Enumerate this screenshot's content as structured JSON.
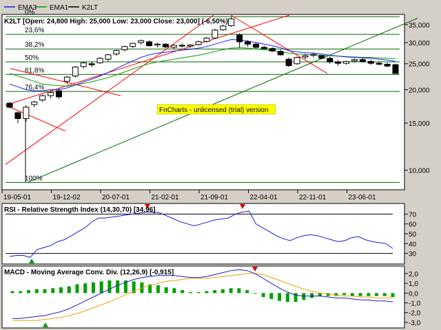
{
  "legend": [
    {
      "name": "EMA3",
      "color": "#1a1aff"
    },
    {
      "name": "EMA1",
      "color": "#00a000"
    },
    {
      "name": "K2LT",
      "color": "#000000"
    }
  ],
  "price_panel": {
    "header": "K2LT [Open: 24,800  High: 25,000  Low: 23,000  Close: 23,000] (-6,50%)",
    "y_ticks": [
      "35,000",
      "30,000",
      "25,000",
      "20,000",
      "15,000",
      "10,000"
    ],
    "x_ticks": [
      "19-05-01",
      "19-12-02",
      "20-07-01",
      "21-02-01",
      "21-09-01",
      "22-04-01",
      "22-11-01",
      "23-06-01"
    ],
    "fib_levels": [
      {
        "label": "0%",
        "value": 37500
      },
      {
        "label": "23,6%",
        "value": 32200
      },
      {
        "label": "38,2%",
        "value": 28400
      },
      {
        "label": "50%",
        "value": 25400
      },
      {
        "label": "61,8%",
        "value": 22800
      },
      {
        "label": "76,4%",
        "value": 19700
      },
      {
        "label": "100%",
        "value": 9000
      }
    ],
    "watermark": "FnCharts - unlicensed (trial) version"
  },
  "rsi_panel": {
    "title": "RSI - Relative Strength Index (14,30,70) [34,96]",
    "y_ticks": [
      "70",
      "60",
      "50",
      "40",
      "30"
    ],
    "overbought": 70,
    "oversold": 30
  },
  "macd_panel": {
    "title": "MACD - Moving Average Conv. Div. (12,26,9) [-0,915]",
    "y_ticks": [
      "2,0",
      "1,0",
      "0,0",
      "-1,0",
      "-2,0",
      "-3,0"
    ]
  },
  "colors": {
    "price_line": "#000000",
    "ema_blue": "#1a1aff",
    "ema_green": "#00a000",
    "trend_red": "#ff0000",
    "fib_green": "#006400",
    "rsi_line": "#1a1acc",
    "macd_line": "#1a1acc",
    "signal_line": "#f0a000",
    "hist_bar": "#00a000",
    "watermark_bg": "#ffff00"
  },
  "chart_data": {
    "type": "candlestick",
    "x_range_labels": [
      "19-05-01",
      "23-06-01"
    ],
    "y_scale": "log",
    "ylim": [
      8500,
      38000
    ],
    "candles": [
      {
        "open": 17800,
        "high": 18000,
        "low": 17000,
        "close": 17200
      },
      {
        "open": 16400,
        "high": 16600,
        "low": 15000,
        "close": 15600
      },
      {
        "open": 15600,
        "high": 17500,
        "low": 15200,
        "close": 17200
      },
      {
        "open": 17600,
        "high": 18200,
        "low": 17200,
        "close": 18000
      },
      {
        "open": 18300,
        "high": 19200,
        "low": 18000,
        "close": 19000
      },
      {
        "open": 19000,
        "high": 19800,
        "low": 18600,
        "close": 19500
      },
      {
        "open": 19800,
        "high": 20200,
        "low": 18500,
        "close": 18800
      },
      {
        "open": 21500,
        "high": 22500,
        "low": 21000,
        "close": 22300
      },
      {
        "open": 22500,
        "high": 24500,
        "low": 22200,
        "close": 24300
      },
      {
        "open": 24400,
        "high": 25500,
        "low": 24000,
        "close": 25200
      },
      {
        "open": 25000,
        "high": 25500,
        "low": 24300,
        "close": 24800
      },
      {
        "open": 25200,
        "high": 26500,
        "low": 25000,
        "close": 26200
      },
      {
        "open": 26000,
        "high": 27200,
        "low": 25500,
        "close": 27000
      },
      {
        "open": 27200,
        "high": 28200,
        "low": 26800,
        "close": 28000
      },
      {
        "open": 28200,
        "high": 29200,
        "low": 27800,
        "close": 29000
      },
      {
        "open": 29000,
        "high": 30000,
        "low": 28600,
        "close": 29800
      },
      {
        "open": 30000,
        "high": 30800,
        "low": 29500,
        "close": 30500
      },
      {
        "open": 30200,
        "high": 30600,
        "low": 29000,
        "close": 29200
      },
      {
        "open": 29400,
        "high": 30000,
        "low": 28800,
        "close": 29600
      },
      {
        "open": 29600,
        "high": 29800,
        "low": 28600,
        "close": 28900
      },
      {
        "open": 28800,
        "high": 29500,
        "low": 28400,
        "close": 29300
      },
      {
        "open": 29300,
        "high": 29800,
        "low": 28800,
        "close": 29100
      },
      {
        "open": 29100,
        "high": 29600,
        "low": 28700,
        "close": 29400
      },
      {
        "open": 29500,
        "high": 30500,
        "low": 29200,
        "close": 30200
      },
      {
        "open": 30300,
        "high": 31500,
        "low": 30000,
        "close": 31200
      },
      {
        "open": 31200,
        "high": 33800,
        "low": 31000,
        "close": 33400
      },
      {
        "open": 33500,
        "high": 35000,
        "low": 33200,
        "close": 34600
      },
      {
        "open": 34700,
        "high": 37500,
        "low": 34300,
        "close": 36800
      },
      {
        "open": 32000,
        "high": 32500,
        "low": 28800,
        "close": 30200
      },
      {
        "open": 30200,
        "high": 30600,
        "low": 29000,
        "close": 29600
      },
      {
        "open": 29600,
        "high": 30000,
        "low": 28400,
        "close": 28800
      },
      {
        "open": 28800,
        "high": 29200,
        "low": 28300,
        "close": 28500
      },
      {
        "open": 28500,
        "high": 28800,
        "low": 27700,
        "close": 27900
      },
      {
        "open": 27800,
        "high": 28200,
        "low": 26800,
        "close": 27000
      },
      {
        "open": 26000,
        "high": 26400,
        "low": 24300,
        "close": 24600
      },
      {
        "open": 25000,
        "high": 26600,
        "low": 24800,
        "close": 26400
      },
      {
        "open": 26500,
        "high": 27200,
        "low": 26000,
        "close": 26800
      },
      {
        "open": 26900,
        "high": 27500,
        "low": 26400,
        "close": 27100
      },
      {
        "open": 26800,
        "high": 27000,
        "low": 26000,
        "close": 26200
      },
      {
        "open": 26200,
        "high": 26600,
        "low": 25000,
        "close": 25400
      },
      {
        "open": 25400,
        "high": 25800,
        "low": 24600,
        "close": 25100
      },
      {
        "open": 25100,
        "high": 25700,
        "low": 24800,
        "close": 25500
      },
      {
        "open": 25600,
        "high": 26200,
        "low": 25300,
        "close": 25900
      },
      {
        "open": 25900,
        "high": 26300,
        "low": 25300,
        "close": 25500
      },
      {
        "open": 25500,
        "high": 25900,
        "low": 24800,
        "close": 25100
      },
      {
        "open": 25100,
        "high": 25500,
        "low": 24700,
        "close": 24900
      },
      {
        "open": 24900,
        "high": 25200,
        "low": 24300,
        "close": 24500
      },
      {
        "open": 24800,
        "high": 25000,
        "low": 23000,
        "close": 23000
      }
    ],
    "ema_blue": [
      21000,
      20500,
      20000,
      19800,
      19800,
      20000,
      20000,
      20300,
      20800,
      21400,
      21900,
      22500,
      23200,
      24000,
      24800,
      25600,
      26400,
      27000,
      27400,
      27600,
      27900,
      28100,
      28300,
      28600,
      29000,
      29600,
      30200,
      30800,
      30700,
      30400,
      30000,
      29600,
      29200,
      28700,
      28000,
      27700,
      27500,
      27400,
      27200,
      26900,
      26700,
      26500,
      26400,
      26300,
      26200,
      26000,
      25800,
      25500
    ],
    "ema_green": [
      23000,
      22500,
      22000,
      21500,
      21000,
      20800,
      20700,
      20600,
      20800,
      21100,
      21400,
      21800,
      22200,
      22700,
      23300,
      23900,
      24500,
      25000,
      25400,
      25700,
      26000,
      26300,
      26600,
      26900,
      27300,
      27800,
      28200,
      28600,
      28700,
      28600,
      28400,
      28200,
      28000,
      27700,
      27400,
      27200,
      27100,
      27000,
      26900,
      26800,
      26700,
      26600,
      26500,
      26400,
      26400,
      26300,
      26200,
      26100
    ],
    "rsi": [
      27,
      28,
      28,
      26,
      34,
      36,
      38,
      42,
      44,
      48,
      52,
      56,
      62,
      66,
      66,
      67,
      68,
      69,
      70,
      71,
      72,
      72,
      71,
      68,
      65,
      62,
      60,
      58,
      60,
      62,
      64,
      65,
      66,
      70,
      72,
      73,
      60,
      56,
      52,
      48,
      45,
      43,
      46,
      48,
      49,
      48,
      46,
      44,
      42,
      43,
      46,
      47,
      44,
      42,
      41,
      40,
      35
    ],
    "macd": [
      -2.6,
      -2.6,
      -2.5,
      -2.4,
      -2.3,
      -2.1,
      -1.9,
      -1.6,
      -1.2,
      -0.8,
      -0.4,
      0.0,
      0.4,
      0.8,
      1.1,
      1.4,
      1.6,
      1.7,
      1.8,
      1.8,
      1.8,
      1.7,
      1.6,
      1.6,
      1.7,
      1.9,
      2.1,
      2.3,
      2.4,
      2.3,
      2.0,
      1.5,
      1.0,
      0.5,
      0.1,
      -0.2,
      -0.3,
      -0.3,
      -0.3,
      -0.4,
      -0.5,
      -0.5,
      -0.6,
      -0.7,
      -0.7,
      -0.8,
      -0.8,
      -0.9
    ],
    "signal": [
      -2.8,
      -2.8,
      -2.8,
      -2.8,
      -2.7,
      -2.6,
      -2.5,
      -2.3,
      -2.1,
      -1.8,
      -1.5,
      -1.2,
      -0.9,
      -0.5,
      -0.2,
      0.2,
      0.5,
      0.8,
      1.0,
      1.2,
      1.3,
      1.4,
      1.5,
      1.5,
      1.5,
      1.6,
      1.7,
      1.8,
      1.9,
      2.0,
      2.0,
      1.9,
      1.6,
      1.3,
      1.0,
      0.7,
      0.4,
      0.2,
      0.0,
      -0.1,
      -0.2,
      -0.3,
      -0.3,
      -0.4,
      -0.4,
      -0.5,
      -0.5,
      -0.5
    ],
    "histogram": [
      0.2,
      0.2,
      0.3,
      0.4,
      0.4,
      0.5,
      0.6,
      0.7,
      0.9,
      1.0,
      1.1,
      1.2,
      1.3,
      1.3,
      1.3,
      1.2,
      1.1,
      0.9,
      0.8,
      0.6,
      0.5,
      0.3,
      0.1,
      0.1,
      0.2,
      0.3,
      0.4,
      0.5,
      0.5,
      0.3,
      0.0,
      -0.4,
      -0.6,
      -0.8,
      -0.9,
      -0.9,
      -0.7,
      -0.5,
      -0.3,
      -0.3,
      -0.3,
      -0.2,
      -0.3,
      -0.3,
      -0.3,
      -0.3,
      -0.3,
      -0.4
    ]
  }
}
